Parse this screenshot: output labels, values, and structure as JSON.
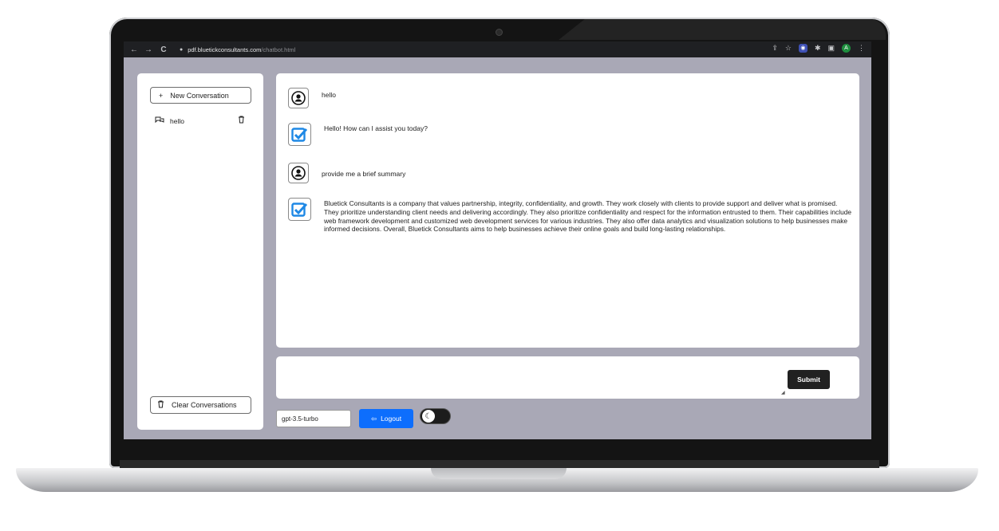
{
  "browser": {
    "url_host": "pdf.bluetickconsultants.com",
    "url_path": "/chatbot.html",
    "nav_back": "←",
    "nav_forward": "→",
    "nav_reload": "C",
    "lock_icon": "🔒",
    "profile_letter": "A"
  },
  "sidebar": {
    "new_conversation_label": "New Conversation",
    "conversations": [
      {
        "title": "hello"
      }
    ],
    "clear_conversations_label": "Clear Conversations"
  },
  "chat": {
    "messages": [
      {
        "role": "user",
        "text": "hello"
      },
      {
        "role": "bot",
        "text": "Hello! How can I assist you today?"
      },
      {
        "role": "user",
        "text": "provide me a brief summary"
      },
      {
        "role": "bot",
        "text": "Bluetick Consultants is a company that values partnership, integrity, confidentiality, and growth. They work closely with clients to provide support and deliver what is promised. They prioritize understanding client needs and delivering accordingly. They also prioritize confidentiality and respect for the information entrusted to them. Their capabilities include web framework development and customized web development services for various industries. They also offer data analytics and visualization solutions to help businesses make informed decisions. Overall, Bluetick Consultants aims to help businesses achieve their online goals and build long-lasting relationships."
      }
    ]
  },
  "composer": {
    "value": "",
    "submit_label": "Submit"
  },
  "footer": {
    "model_value": "gpt-3.5-turbo",
    "logout_label": "Logout"
  },
  "colors": {
    "accent": "#0d6efd",
    "bot_check": "#1e88e5",
    "submit_bg": "#212121",
    "app_bg": "#a9a8b6"
  },
  "icons": [
    "arrow-left-icon",
    "arrow-right-icon",
    "reload-icon",
    "lock-icon",
    "share-icon",
    "star-icon",
    "extension-icon",
    "puzzle-icon",
    "sidebar-icon",
    "menu-icon",
    "plus-icon",
    "chat-icon",
    "trash-icon",
    "user-icon",
    "checkbox-icon",
    "logout-icon",
    "moon-icon"
  ]
}
